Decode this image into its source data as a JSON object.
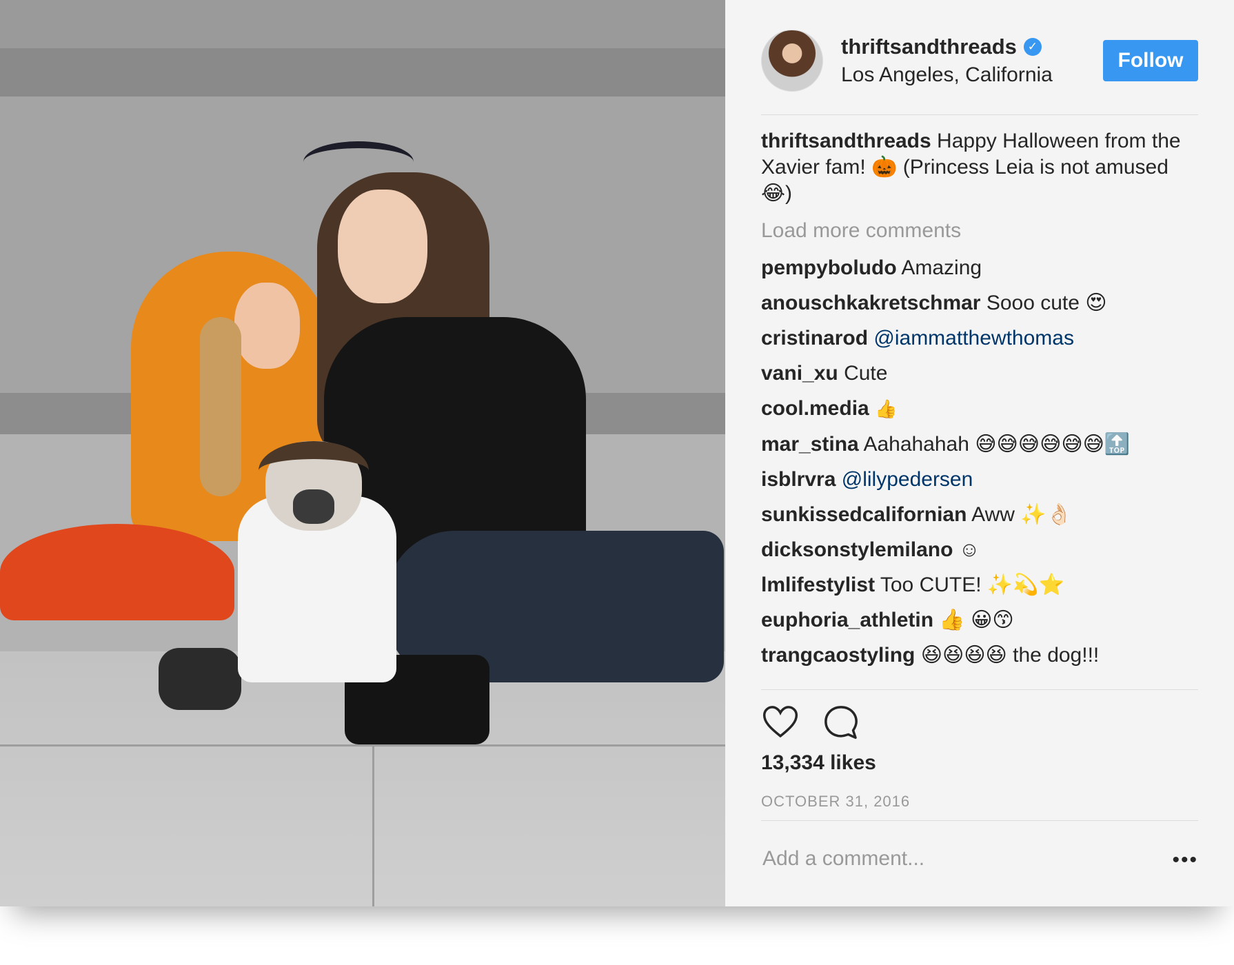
{
  "post": {
    "username": "thriftsandthreads",
    "verified_icon": "verified-badge-icon",
    "location": "Los Angeles, California",
    "follow_label": "Follow",
    "caption": {
      "username": "thriftsandthreads",
      "text": "Happy Halloween from the Xavier fam! 🎃 (Princess Leia is not amused 😂)"
    },
    "load_more_label": "Load more comments",
    "comments": [
      {
        "user": "pempyboludo",
        "text": "Amazing"
      },
      {
        "user": "anouschkakretschmar",
        "text": "Sooo cute 😍"
      },
      {
        "user": "cristinarod",
        "mention": "@iammatthewthomas"
      },
      {
        "user": "vani_xu",
        "text": "Cute"
      },
      {
        "user": "cool.media",
        "text": "👍"
      },
      {
        "user": "mar_stina",
        "text": "Aahahahah 😅😅😅😅😅😅🔝"
      },
      {
        "user": "isblrvra",
        "mention": "@lilypedersen"
      },
      {
        "user": "sunkissedcalifornian",
        "text": "Aww ✨👌🏻"
      },
      {
        "user": "dicksonstylemilano",
        "text": "☺"
      },
      {
        "user": "lmlifestylist",
        "text": "Too CUTE! ✨💫⭐"
      },
      {
        "user": "euphoria_athletin",
        "text": "👍 😀😙"
      },
      {
        "user": "trangcaostyling",
        "text": "😆😆😆😆 the dog!!!"
      }
    ],
    "likes": "13,334 likes",
    "date": "OCTOBER 31, 2016",
    "add_comment_placeholder": "Add a comment...",
    "more_options": "•••"
  },
  "colors": {
    "accent": "#3897f0",
    "mention": "#003569",
    "muted": "#999999",
    "text": "#262626"
  },
  "icons": {
    "like": "heart-icon",
    "comment": "comment-bubble-icon",
    "more": "more-options-icon"
  }
}
